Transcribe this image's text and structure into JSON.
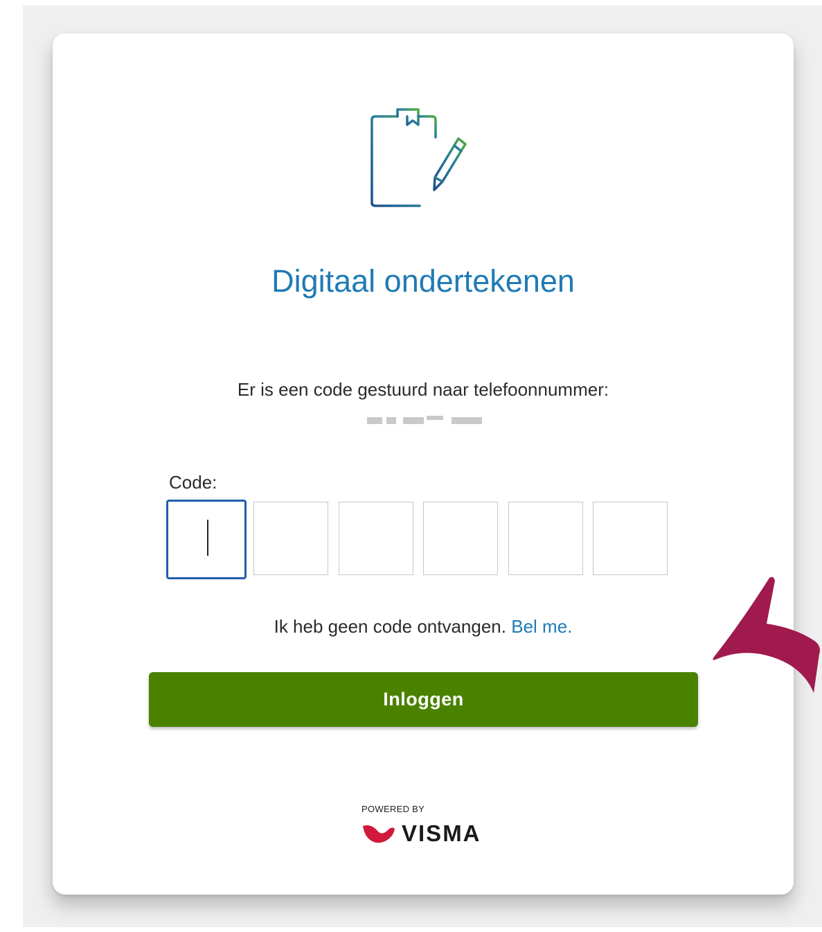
{
  "page": {
    "title": "Digitaal ondertekenen",
    "info_text": "Er is een code gestuurd naar telefoonnummer:",
    "code_label": "Code:",
    "code_digits": [
      "",
      "",
      "",
      "",
      "",
      ""
    ],
    "no_code_text": "Ik heb geen code ontvangen.",
    "call_me_link": "Bel me.",
    "login_button": "Inloggen",
    "powered_by": "POWERED BY",
    "brand": "VISMA"
  },
  "icons": {
    "header": "document-sign-icon",
    "brand_mark": "visma-logo-icon",
    "annotation": "arrow-annotation-icon"
  },
  "colors": {
    "title": "#1f7bb5",
    "link": "#1f7bb5",
    "button": "#4a8200",
    "active_border": "#1f5faa",
    "arrow": "#a01a4e",
    "brand_mark": "#d0193c"
  }
}
